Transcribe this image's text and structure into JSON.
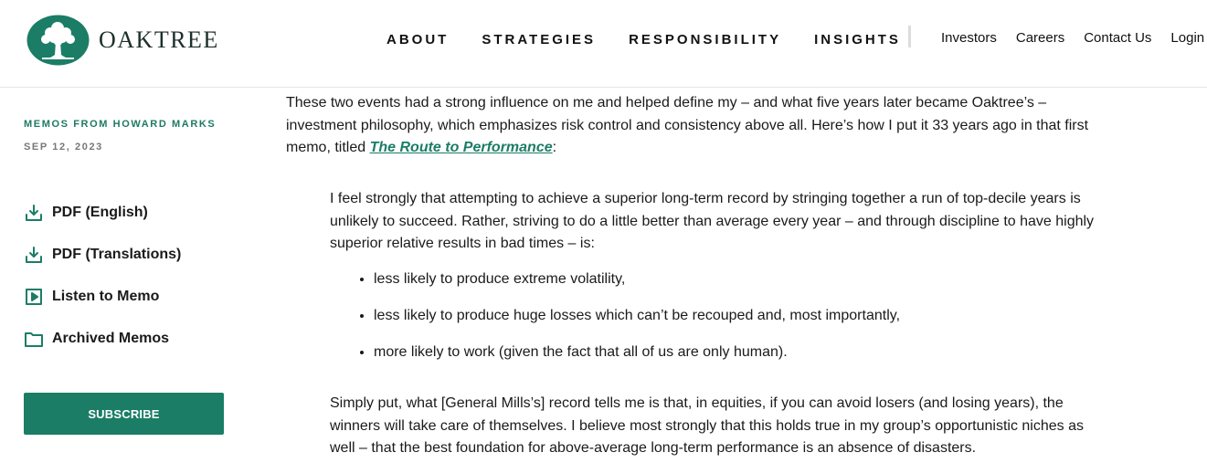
{
  "header": {
    "logo_text": "OAKTREE",
    "main_nav": [
      "ABOUT",
      "STRATEGIES",
      "RESPONSIBILITY",
      "INSIGHTS"
    ],
    "util_nav": [
      "Investors",
      "Careers",
      "Contact Us",
      "Login"
    ]
  },
  "sidebar": {
    "eyebrow": "MEMOS FROM HOWARD MARKS",
    "date": "SEP 12, 2023",
    "links": [
      {
        "label": "PDF (English)",
        "icon": "download-icon"
      },
      {
        "label": "PDF (Translations)",
        "icon": "download-icon"
      },
      {
        "label": "Listen to Memo",
        "icon": "play-icon"
      },
      {
        "label": "Archived Memos",
        "icon": "folder-icon"
      }
    ],
    "subscribe_label": "SUBSCRIBE"
  },
  "article": {
    "intro_before_link": "These two events had a strong influence on me and helped define my – and what five years later became Oaktree’s – investment philosophy, which emphasizes risk control and consistency above all. Here’s how I put it 33 years ago in that first memo, titled ",
    "intro_link": "The Route to Performance",
    "intro_after_link": ":",
    "quote_1": "I feel strongly that attempting to achieve a superior long-term record by stringing together a run of top-decile years is unlikely to succeed. Rather, striving to do a little better than average every year – and through discipline to have highly superior relative results in bad times – is:",
    "bullets": [
      "less likely to produce extreme volatility,",
      "less likely to produce huge losses which can’t be recouped and, most importantly,",
      "more likely to work (given the fact that all of us are only human)."
    ],
    "quote_2": "Simply put, what [General Mills’s] record tells me is that, in equities, if you can avoid losers (and losing years), the winners will take care of themselves. I believe most strongly that this holds true in my group’s opportunistic niches as well – that the best foundation for above-average long-term performance is an absence of disasters."
  },
  "colors": {
    "brand_green": "#1b7d66",
    "eyebrow_green": "#1d7a63",
    "date_gray": "#777777"
  }
}
